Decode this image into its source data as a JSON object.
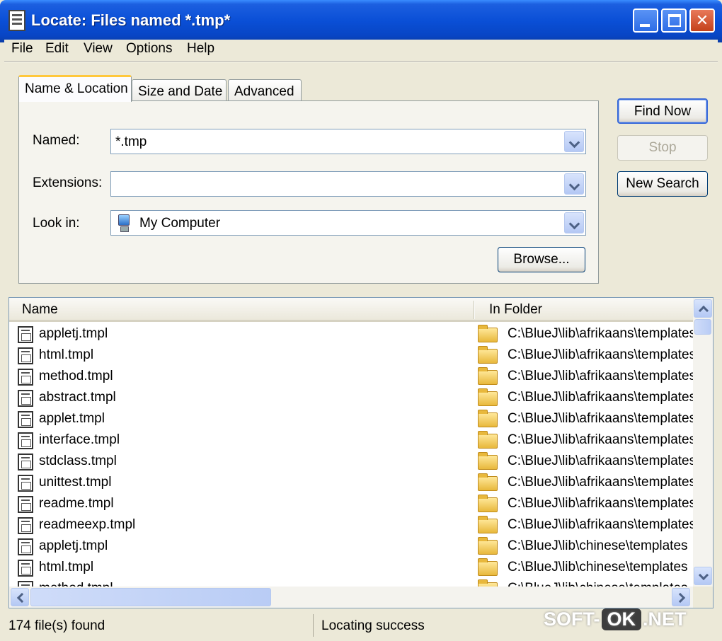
{
  "window": {
    "title": "Locate: Files named *.tmp*"
  },
  "menu": [
    "File",
    "Edit",
    "View",
    "Options",
    "Help"
  ],
  "tabs": [
    "Name & Location",
    "Size and Date",
    "Advanced"
  ],
  "form": {
    "named_label": "Named:",
    "named_value": "*.tmp",
    "extensions_label": "Extensions:",
    "extensions_value": "",
    "lookin_label": "Look in:",
    "lookin_value": "My Computer",
    "browse_label": "Browse..."
  },
  "actions": {
    "find_now": "Find Now",
    "stop": "Stop",
    "new_search": "New Search"
  },
  "list": {
    "columns": [
      "Name",
      "In Folder"
    ],
    "rows": [
      {
        "name": "appletj.tmpl",
        "folder": "C:\\BlueJ\\lib\\afrikaans\\templates"
      },
      {
        "name": "html.tmpl",
        "folder": "C:\\BlueJ\\lib\\afrikaans\\templates"
      },
      {
        "name": "method.tmpl",
        "folder": "C:\\BlueJ\\lib\\afrikaans\\templates"
      },
      {
        "name": "abstract.tmpl",
        "folder": "C:\\BlueJ\\lib\\afrikaans\\templates"
      },
      {
        "name": "applet.tmpl",
        "folder": "C:\\BlueJ\\lib\\afrikaans\\templates"
      },
      {
        "name": "interface.tmpl",
        "folder": "C:\\BlueJ\\lib\\afrikaans\\templates"
      },
      {
        "name": "stdclass.tmpl",
        "folder": "C:\\BlueJ\\lib\\afrikaans\\templates"
      },
      {
        "name": "unittest.tmpl",
        "folder": "C:\\BlueJ\\lib\\afrikaans\\templates"
      },
      {
        "name": "readme.tmpl",
        "folder": "C:\\BlueJ\\lib\\afrikaans\\templates"
      },
      {
        "name": "readmeexp.tmpl",
        "folder": "C:\\BlueJ\\lib\\afrikaans\\templates"
      },
      {
        "name": "appletj.tmpl",
        "folder": "C:\\BlueJ\\lib\\chinese\\templates"
      },
      {
        "name": "html.tmpl",
        "folder": "C:\\BlueJ\\lib\\chinese\\templates"
      },
      {
        "name": "method.tmpl",
        "folder": "C:\\BlueJ\\lib\\chinese\\templates"
      }
    ]
  },
  "status": {
    "count": "174 file(s) found",
    "message": "Locating success"
  },
  "watermark": {
    "pre": "SOFT-",
    "ok": "OK",
    "post": ".NET"
  }
}
